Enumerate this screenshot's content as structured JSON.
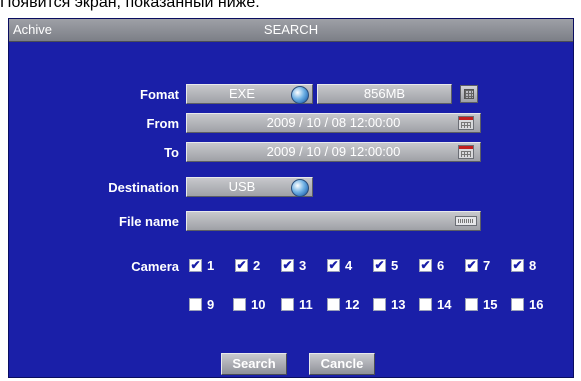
{
  "caption": "Появится экран, показанный ниже.",
  "window": {
    "left_title": "Achive",
    "title": "SEARCH"
  },
  "form": {
    "format": {
      "label": "Fomat",
      "value": "EXE",
      "size": "856MB"
    },
    "from": {
      "label": "From",
      "value": "2009 / 10 / 08  12:00:00"
    },
    "to": {
      "label": "To",
      "value": "2009 / 10 / 09  12:00:00"
    },
    "destination": {
      "label": "Destination",
      "value": "USB"
    },
    "file_name": {
      "label": "File name",
      "value": ""
    }
  },
  "camera": {
    "label": "Camera",
    "items": [
      {
        "num": "1",
        "checked": true
      },
      {
        "num": "2",
        "checked": true
      },
      {
        "num": "3",
        "checked": true
      },
      {
        "num": "4",
        "checked": true
      },
      {
        "num": "5",
        "checked": true
      },
      {
        "num": "6",
        "checked": true
      },
      {
        "num": "7",
        "checked": true
      },
      {
        "num": "8",
        "checked": true
      },
      {
        "num": "9",
        "checked": false
      },
      {
        "num": "10",
        "checked": false
      },
      {
        "num": "11",
        "checked": false
      },
      {
        "num": "12",
        "checked": false
      },
      {
        "num": "13",
        "checked": false
      },
      {
        "num": "14",
        "checked": false
      },
      {
        "num": "15",
        "checked": false
      },
      {
        "num": "16",
        "checked": false
      }
    ]
  },
  "buttons": {
    "search": "Search",
    "cancel": "Cancle"
  },
  "icons": {
    "dropdown": "dropdown-globe-icon",
    "calendar": "calendar-icon",
    "calculator": "calculator-icon",
    "keyboard": "keyboard-icon",
    "checkbox_mark": "✔"
  },
  "colors": {
    "panel_bg": "#1a1fa8",
    "field_bg": "#b3b5ba",
    "title_bar": "#8d9097"
  }
}
